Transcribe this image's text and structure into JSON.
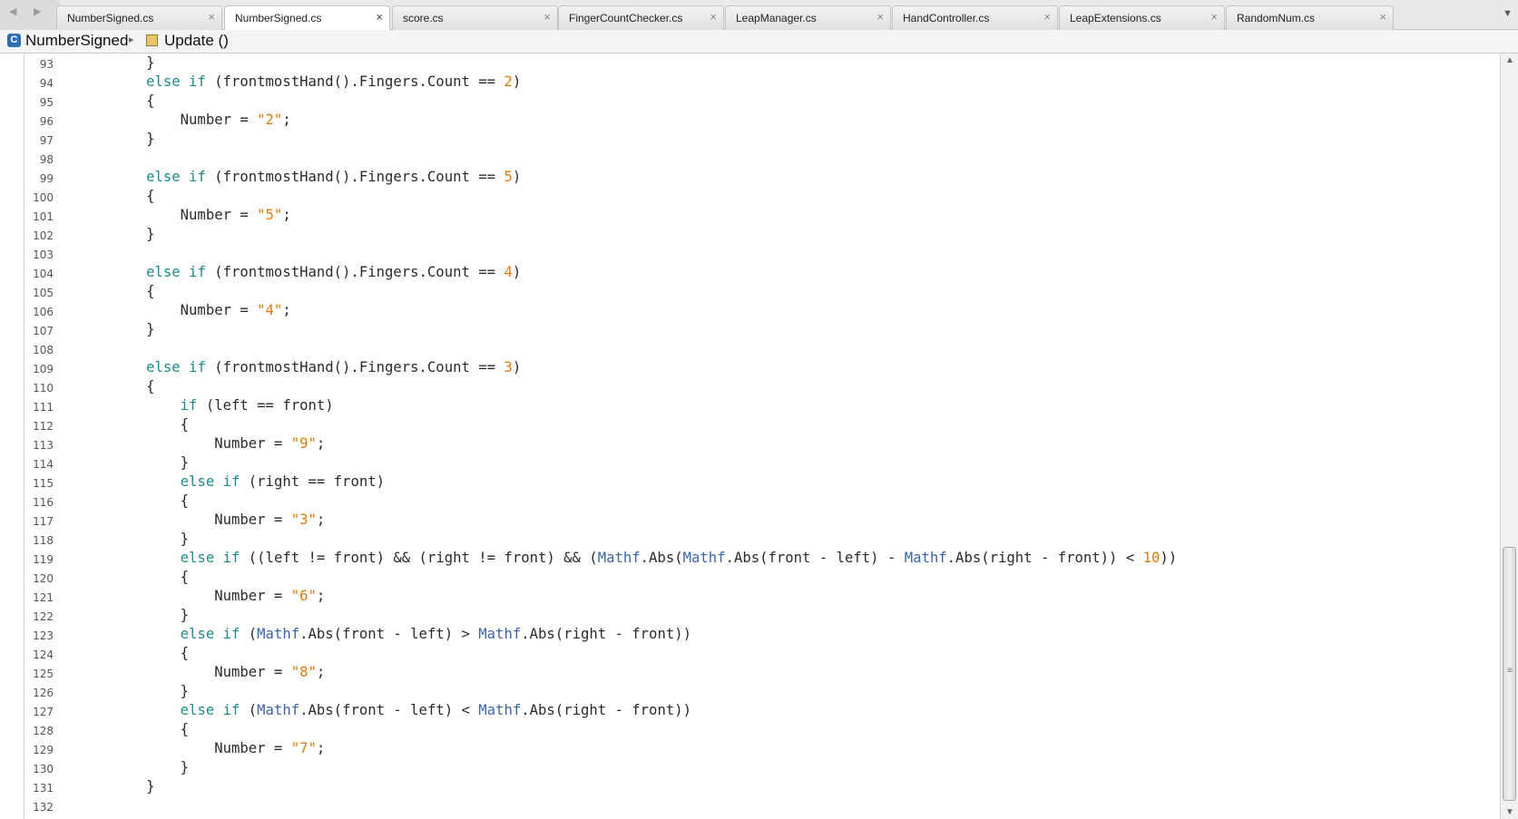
{
  "tabs": [
    {
      "label": "NumberSigned.cs",
      "active": false
    },
    {
      "label": "NumberSigned.cs",
      "active": true
    },
    {
      "label": "score.cs",
      "active": false
    },
    {
      "label": "FingerCountChecker.cs",
      "active": false
    },
    {
      "label": "LeapManager.cs",
      "active": false
    },
    {
      "label": "HandController.cs",
      "active": false
    },
    {
      "label": "LeapExtensions.cs",
      "active": false
    },
    {
      "label": "RandomNum.cs",
      "active": false
    }
  ],
  "icons": {
    "close": "×",
    "nav_back": "◀",
    "nav_forward": "▶",
    "menu": "▼",
    "breadcrumb_sep": "▸",
    "class_icon_letter": "C",
    "scroll_up": "▲",
    "scroll_down": "▼",
    "grip": "≡"
  },
  "breadcrumb": {
    "class_name": "NumberSigned",
    "method_name": "Update ()"
  },
  "colors": {
    "keyword": "#1f8a8a",
    "number_literal": "#e07b0b",
    "type_name": "#3a64a8"
  },
  "code_lines": [
    {
      "n": "93",
      "tokens": [
        [
          "t",
          "        }"
        ]
      ]
    },
    {
      "n": "94",
      "tokens": [
        [
          "t",
          "        "
        ],
        [
          "k",
          "else if"
        ],
        [
          "t",
          " (frontmostHand().Fingers.Count == "
        ],
        [
          "n",
          "2"
        ],
        [
          "t",
          ")"
        ]
      ]
    },
    {
      "n": "95",
      "tokens": [
        [
          "t",
          "        {"
        ]
      ]
    },
    {
      "n": "96",
      "tokens": [
        [
          "t",
          "            Number = "
        ],
        [
          "s",
          "\"2\""
        ],
        [
          "t",
          ";"
        ]
      ]
    },
    {
      "n": "97",
      "tokens": [
        [
          "t",
          "        }"
        ]
      ]
    },
    {
      "n": "98",
      "tokens": []
    },
    {
      "n": "99",
      "tokens": [
        [
          "t",
          "        "
        ],
        [
          "k",
          "else if"
        ],
        [
          "t",
          " (frontmostHand().Fingers.Count == "
        ],
        [
          "n",
          "5"
        ],
        [
          "t",
          ")"
        ]
      ]
    },
    {
      "n": "100",
      "tokens": [
        [
          "t",
          "        {"
        ]
      ]
    },
    {
      "n": "101",
      "tokens": [
        [
          "t",
          "            Number = "
        ],
        [
          "s",
          "\"5\""
        ],
        [
          "t",
          ";"
        ]
      ]
    },
    {
      "n": "102",
      "tokens": [
        [
          "t",
          "        }"
        ]
      ]
    },
    {
      "n": "103",
      "tokens": []
    },
    {
      "n": "104",
      "tokens": [
        [
          "t",
          "        "
        ],
        [
          "k",
          "else if"
        ],
        [
          "t",
          " (frontmostHand().Fingers.Count == "
        ],
        [
          "n",
          "4"
        ],
        [
          "t",
          ")"
        ]
      ]
    },
    {
      "n": "105",
      "tokens": [
        [
          "t",
          "        {"
        ]
      ]
    },
    {
      "n": "106",
      "tokens": [
        [
          "t",
          "            Number = "
        ],
        [
          "s",
          "\"4\""
        ],
        [
          "t",
          ";"
        ]
      ]
    },
    {
      "n": "107",
      "tokens": [
        [
          "t",
          "        }"
        ]
      ]
    },
    {
      "n": "108",
      "tokens": []
    },
    {
      "n": "109",
      "tokens": [
        [
          "t",
          "        "
        ],
        [
          "k",
          "else if"
        ],
        [
          "t",
          " (frontmostHand().Fingers.Count == "
        ],
        [
          "n",
          "3"
        ],
        [
          "t",
          ")"
        ]
      ]
    },
    {
      "n": "110",
      "tokens": [
        [
          "t",
          "        {"
        ]
      ]
    },
    {
      "n": "111",
      "tokens": [
        [
          "t",
          "            "
        ],
        [
          "k",
          "if"
        ],
        [
          "t",
          " (left == front)"
        ]
      ]
    },
    {
      "n": "112",
      "tokens": [
        [
          "t",
          "            {"
        ]
      ]
    },
    {
      "n": "113",
      "tokens": [
        [
          "t",
          "                Number = "
        ],
        [
          "s",
          "\"9\""
        ],
        [
          "t",
          ";"
        ]
      ]
    },
    {
      "n": "114",
      "tokens": [
        [
          "t",
          "            }"
        ]
      ]
    },
    {
      "n": "115",
      "tokens": [
        [
          "t",
          "            "
        ],
        [
          "k",
          "else if"
        ],
        [
          "t",
          " (right == front)"
        ]
      ]
    },
    {
      "n": "116",
      "tokens": [
        [
          "t",
          "            {"
        ]
      ]
    },
    {
      "n": "117",
      "tokens": [
        [
          "t",
          "                Number = "
        ],
        [
          "s",
          "\"3\""
        ],
        [
          "t",
          ";"
        ]
      ]
    },
    {
      "n": "118",
      "tokens": [
        [
          "t",
          "            }"
        ]
      ]
    },
    {
      "n": "119",
      "tokens": [
        [
          "t",
          "            "
        ],
        [
          "k",
          "else if"
        ],
        [
          "t",
          " ((left != front) && (right != front) && ("
        ],
        [
          "y",
          "Mathf"
        ],
        [
          "t",
          ".Abs("
        ],
        [
          "y",
          "Mathf"
        ],
        [
          "t",
          ".Abs(front - left) - "
        ],
        [
          "y",
          "Mathf"
        ],
        [
          "t",
          ".Abs(right - front)) < "
        ],
        [
          "n",
          "10"
        ],
        [
          "t",
          "))"
        ]
      ]
    },
    {
      "n": "120",
      "tokens": [
        [
          "t",
          "            {"
        ]
      ]
    },
    {
      "n": "121",
      "tokens": [
        [
          "t",
          "                Number = "
        ],
        [
          "s",
          "\"6\""
        ],
        [
          "t",
          ";"
        ]
      ]
    },
    {
      "n": "122",
      "tokens": [
        [
          "t",
          "            }"
        ]
      ]
    },
    {
      "n": "123",
      "tokens": [
        [
          "t",
          "            "
        ],
        [
          "k",
          "else if"
        ],
        [
          "t",
          " ("
        ],
        [
          "y",
          "Mathf"
        ],
        [
          "t",
          ".Abs(front - left) > "
        ],
        [
          "y",
          "Mathf"
        ],
        [
          "t",
          ".Abs(right - front))"
        ]
      ]
    },
    {
      "n": "124",
      "tokens": [
        [
          "t",
          "            {"
        ]
      ]
    },
    {
      "n": "125",
      "tokens": [
        [
          "t",
          "                Number = "
        ],
        [
          "s",
          "\"8\""
        ],
        [
          "t",
          ";"
        ]
      ]
    },
    {
      "n": "126",
      "tokens": [
        [
          "t",
          "            }"
        ]
      ]
    },
    {
      "n": "127",
      "tokens": [
        [
          "t",
          "            "
        ],
        [
          "k",
          "else if"
        ],
        [
          "t",
          " ("
        ],
        [
          "y",
          "Mathf"
        ],
        [
          "t",
          ".Abs(front - left) < "
        ],
        [
          "y",
          "Mathf"
        ],
        [
          "t",
          ".Abs(right - front))"
        ]
      ]
    },
    {
      "n": "128",
      "tokens": [
        [
          "t",
          "            {"
        ]
      ]
    },
    {
      "n": "129",
      "tokens": [
        [
          "t",
          "                Number = "
        ],
        [
          "s",
          "\"7\""
        ],
        [
          "t",
          ";"
        ]
      ]
    },
    {
      "n": "130",
      "tokens": [
        [
          "t",
          "            }"
        ]
      ]
    },
    {
      "n": "131",
      "tokens": [
        [
          "t",
          "        }"
        ]
      ]
    },
    {
      "n": "132",
      "tokens": []
    }
  ]
}
